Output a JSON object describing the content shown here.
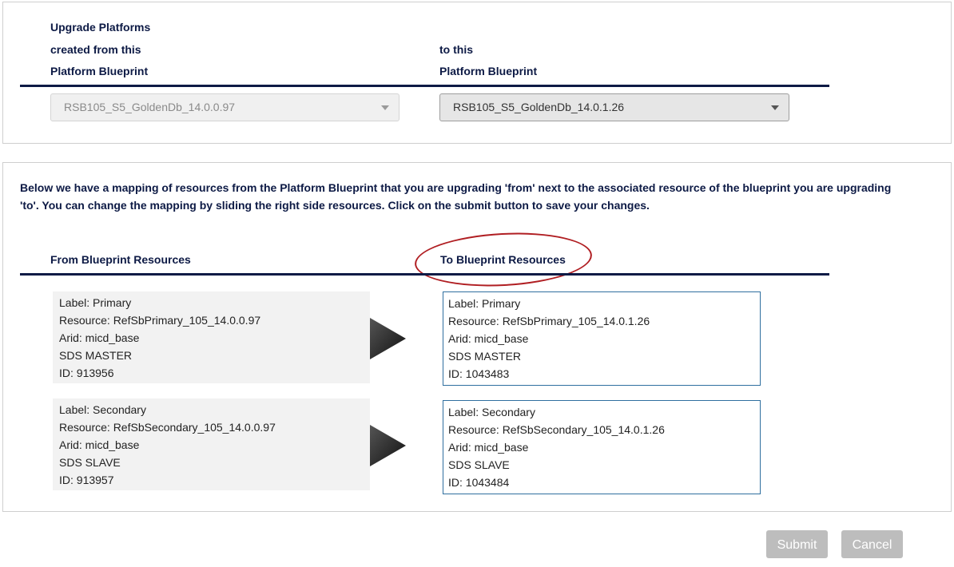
{
  "header": {
    "title": "Upgrade Platforms",
    "from_line1": "created from this",
    "from_line2": "Platform Blueprint",
    "to_line1": "to this",
    "to_line2": "Platform Blueprint"
  },
  "from_select": {
    "value": "RSB105_S5_GoldenDb_14.0.0.97",
    "disabled": true
  },
  "to_select": {
    "value": "RSB105_S5_GoldenDb_14.0.1.26",
    "disabled": false
  },
  "description": "Below we have a mapping of resources from the Platform Blueprint that you are upgrading 'from' next to the associated resource of the blueprint you are upgrading 'to'. You can change the mapping by sliding the right side resources. Click on the submit button to save your changes.",
  "mapping": {
    "from_header": "From Blueprint Resources",
    "to_header": "To Blueprint Resources",
    "from_resources": [
      {
        "label": "Label:  Primary",
        "resource": "Resource: RefSbPrimary_105_14.0.0.97",
        "arid": "Arid: micd_base",
        "role": "SDS MASTER",
        "id": "ID: 913956"
      },
      {
        "label": "Label:  Secondary",
        "resource": "Resource: RefSbSecondary_105_14.0.0.97",
        "arid": "Arid: micd_base",
        "role": "SDS SLAVE",
        "id": "ID: 913957"
      }
    ],
    "to_resources": [
      {
        "label": "Label:  Primary",
        "resource": "Resource: RefSbPrimary_105_14.0.1.26",
        "arid": "Arid: micd_base",
        "role": "SDS MASTER",
        "id": "ID: 1043483"
      },
      {
        "label": "Label:  Secondary",
        "resource": "Resource: RefSbSecondary_105_14.0.1.26",
        "arid": "Arid: micd_base",
        "role": "SDS SLAVE",
        "id": "ID: 1043484"
      }
    ]
  },
  "buttons": {
    "submit": "Submit",
    "cancel": "Cancel"
  },
  "icons": {
    "arrow": "play-arrow-icon",
    "dropdown": "chevron-down-icon"
  },
  "colors": {
    "heading": "#0d1a45",
    "annotation": "#b01e22",
    "button": "#bdbdbd",
    "card_border": "#2f6f9f"
  }
}
